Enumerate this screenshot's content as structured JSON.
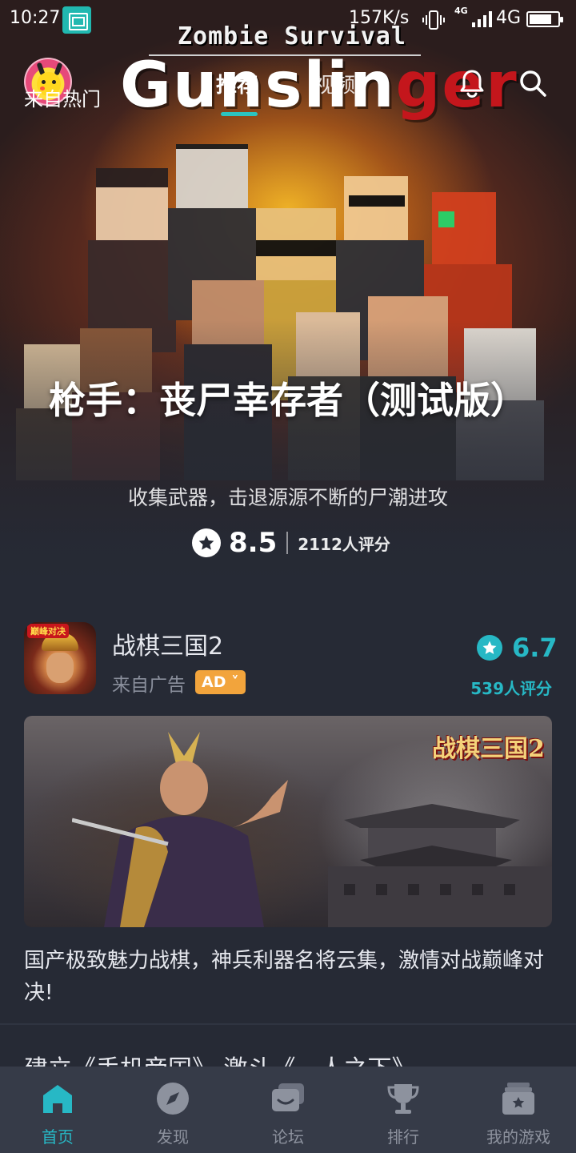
{
  "status_bar": {
    "time": "10:27",
    "net_speed": "157K/s",
    "network_small": "4G",
    "network": "4G",
    "battery_level": 0.8
  },
  "top_nav": {
    "tabs": [
      {
        "label": "推荐",
        "active": true
      },
      {
        "label": "视频",
        "active": false
      }
    ],
    "avatar_icon": "pikachu-avatar",
    "notification_icon": "bell-icon",
    "search_icon": "search-icon"
  },
  "hero": {
    "source_label": "来自热门",
    "logo_top": "Zombie Survival",
    "logo_main_white": "Gunslin",
    "logo_main_red": "ger",
    "title": "枪手：丧尸幸存者（测试版）",
    "subtitle": "收集武器，击退源源不断的尸潮进攻",
    "score": "8.5",
    "rating_count": "2112人评分"
  },
  "ad_card": {
    "icon_tag": "巅峰对决",
    "name": "战棋三国2",
    "source_label": "来自广告",
    "badge": "AD",
    "score": "6.7",
    "rating_count": "539人评分",
    "banner_logo": "战棋三国2",
    "description": "国产极致魅力战棋，神兵利器名将云集，激情对战巅峰对决!"
  },
  "next_item": {
    "title": "建立《手机帝国》 激斗《一人之下》"
  },
  "bottom_nav": [
    {
      "label": "首页",
      "icon": "home-icon",
      "active": true
    },
    {
      "label": "发现",
      "icon": "compass-icon",
      "active": false
    },
    {
      "label": "论坛",
      "icon": "forum-icon",
      "active": false
    },
    {
      "label": "排行",
      "icon": "trophy-icon",
      "active": false
    },
    {
      "label": "我的游戏",
      "icon": "my-games-icon",
      "active": false
    }
  ],
  "colors": {
    "accent": "#27b8c5",
    "background": "#262a35",
    "nav_background": "#363b48",
    "ad_badge": "#f2a43c"
  }
}
